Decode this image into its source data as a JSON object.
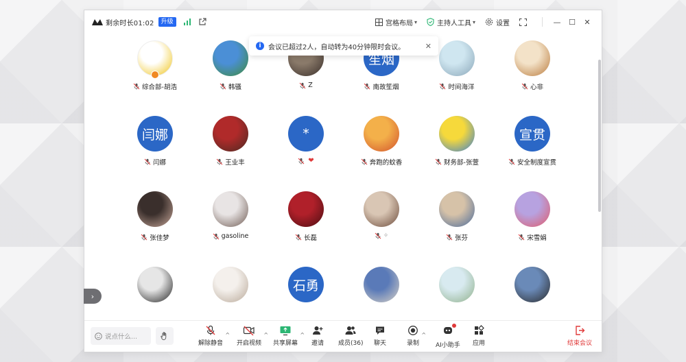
{
  "titlebar": {
    "remaining_time": "剩余时长01:02",
    "upgrade_label": "升级",
    "layout_label": "宫格布局",
    "host_tools_label": "主持人工具",
    "settings_label": "设置"
  },
  "toast": {
    "message": "会议已超过2人，自动转为40分钟限时会议。"
  },
  "participants": [
    {
      "name": "综合部-胡浩",
      "avatar_type": "image",
      "colors": [
        "#ffffff",
        "#f0c419"
      ],
      "is_host": true
    },
    {
      "name": "韩骚",
      "avatar_type": "image",
      "colors": [
        "#4b8fd6",
        "#3f8b3a"
      ]
    },
    {
      "name": "Z",
      "avatar_type": "image",
      "colors": [
        "#8a7a6a",
        "#3a2f2a"
      ]
    },
    {
      "name": "南故笙烟",
      "avatar_type": "text",
      "avatar_text": "笙烟"
    },
    {
      "name": "时间海洋",
      "avatar_type": "image",
      "colors": [
        "#cfe6f0",
        "#8aa6b8"
      ]
    },
    {
      "name": "心非",
      "avatar_type": "image",
      "colors": [
        "#f3e2c8",
        "#b97a3c"
      ]
    },
    {
      "name": "闫娜",
      "avatar_type": "text",
      "avatar_text": "闫娜"
    },
    {
      "name": "王业丰",
      "avatar_type": "image",
      "colors": [
        "#b02a2a",
        "#4a2a22"
      ]
    },
    {
      "name": "",
      "avatar_type": "text",
      "avatar_text": "*",
      "heart": "❤"
    },
    {
      "name": "奔跑的蚊香",
      "avatar_type": "image",
      "colors": [
        "#f3b04a",
        "#d2522c"
      ]
    },
    {
      "name": "财务部-张萱",
      "avatar_type": "image",
      "colors": [
        "#f6d93b",
        "#3b7fd0"
      ]
    },
    {
      "name": "安全制度宣贯",
      "avatar_type": "text",
      "avatar_text": "宣贯"
    },
    {
      "name": "张佳梦",
      "avatar_type": "image",
      "colors": [
        "#3a2f2c",
        "#c9a89a"
      ]
    },
    {
      "name": "gasoline",
      "avatar_type": "image",
      "colors": [
        "#e8e4e4",
        "#6e5a52"
      ]
    },
    {
      "name": "长磊",
      "avatar_type": "image",
      "colors": [
        "#b0202a",
        "#4a0e12"
      ]
    },
    {
      "name": "",
      "avatar_type": "image",
      "colors": [
        "#d9c6b4",
        "#6b4a3a"
      ],
      "trailing_mark": "✧"
    },
    {
      "name": "张芬",
      "avatar_type": "image",
      "colors": [
        "#d6c2a8",
        "#4a6a9a"
      ]
    },
    {
      "name": "宋雪娟",
      "avatar_type": "image",
      "colors": [
        "#b7a2e0",
        "#e05a6a"
      ]
    },
    {
      "name": "",
      "avatar_type": "image",
      "colors": [
        "#e6e6e6",
        "#222222"
      ]
    },
    {
      "name": "",
      "avatar_type": "image",
      "colors": [
        "#f4f0ec",
        "#b8a898"
      ]
    },
    {
      "name": "",
      "avatar_type": "text",
      "avatar_text": "石勇"
    },
    {
      "name": "",
      "avatar_type": "image",
      "colors": [
        "#5a7ab8",
        "#d9d2c6"
      ]
    },
    {
      "name": "",
      "avatar_type": "image",
      "colors": [
        "#d8eaf0",
        "#8fb08a"
      ]
    },
    {
      "name": "",
      "avatar_type": "image",
      "colors": [
        "#6a8ab8",
        "#2a2a2a"
      ]
    }
  ],
  "toolbar": {
    "chat_placeholder": "说点什么...",
    "items": [
      {
        "label": "解除静音",
        "icon": "mic-off-icon"
      },
      {
        "label": "开启视频",
        "icon": "video-off-icon"
      },
      {
        "label": "共享屏幕",
        "icon": "share-screen-icon"
      },
      {
        "label": "邀请",
        "icon": "invite-icon"
      },
      {
        "label": "成员(36)",
        "icon": "members-icon"
      },
      {
        "label": "聊天",
        "icon": "chat-icon"
      },
      {
        "label": "录制",
        "icon": "record-icon"
      },
      {
        "label": "AI小助手",
        "icon": "ai-assistant-icon"
      },
      {
        "label": "应用",
        "icon": "apps-icon"
      }
    ],
    "end_label": "结束会议"
  },
  "colors": {
    "accent": "#2468f2",
    "avatar_blue": "#2b67c6",
    "end_red": "#e03a3a",
    "host_orange": "#f08a24"
  }
}
